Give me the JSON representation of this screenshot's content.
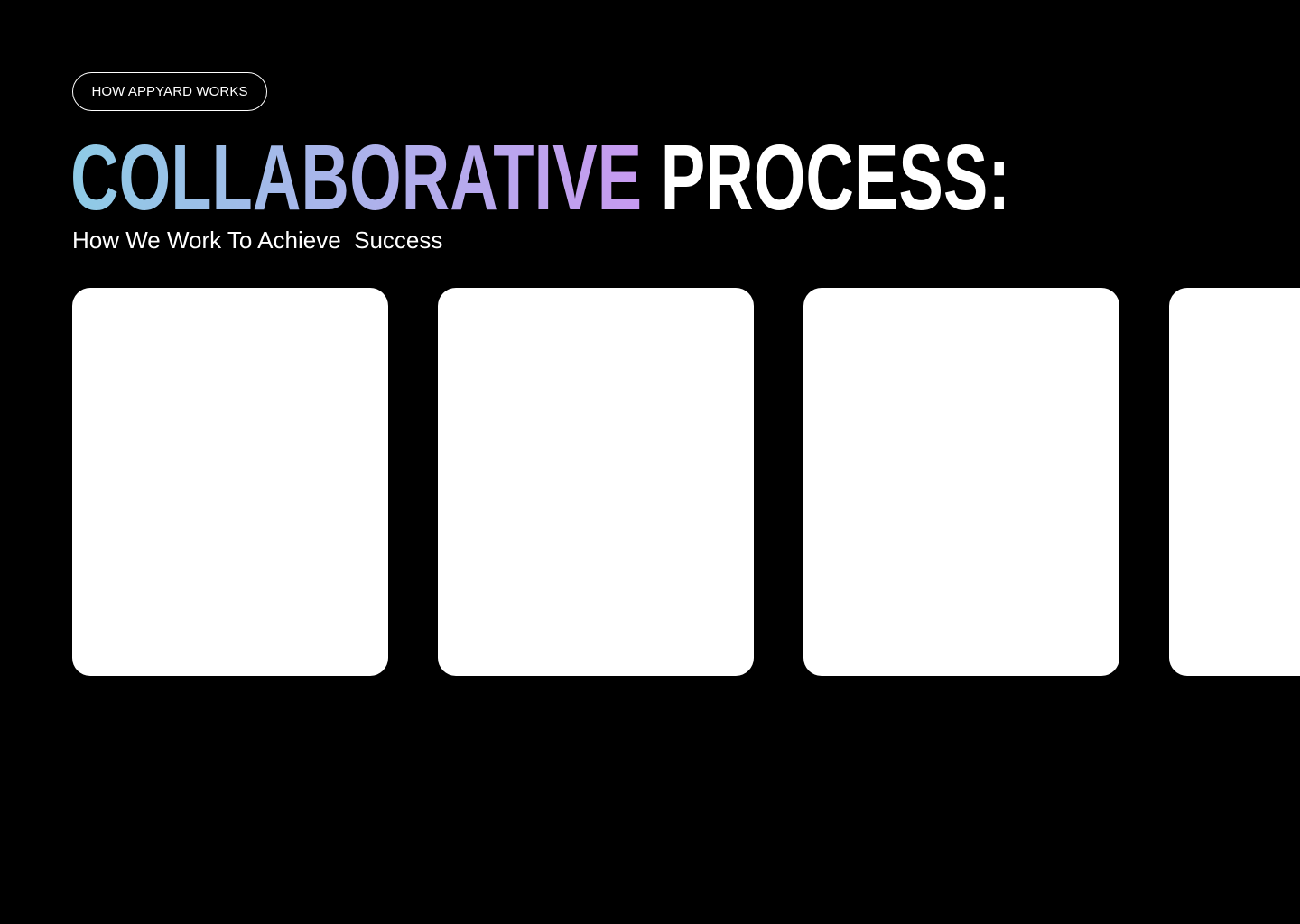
{
  "section": {
    "label": "HOW APPYARD WORKS"
  },
  "hero": {
    "headline_gradient": "COLLABORATIVE",
    "headline_plain": "PROCESS:",
    "subtitle": "How We Work To Achieve  Success"
  },
  "cards": [
    {},
    {},
    {},
    {}
  ],
  "colors": {
    "background": "#000000",
    "text": "#ffffff",
    "card": "#ffffff",
    "gradient_start": "#8ecbe6",
    "gradient_end": "#c79af0"
  }
}
